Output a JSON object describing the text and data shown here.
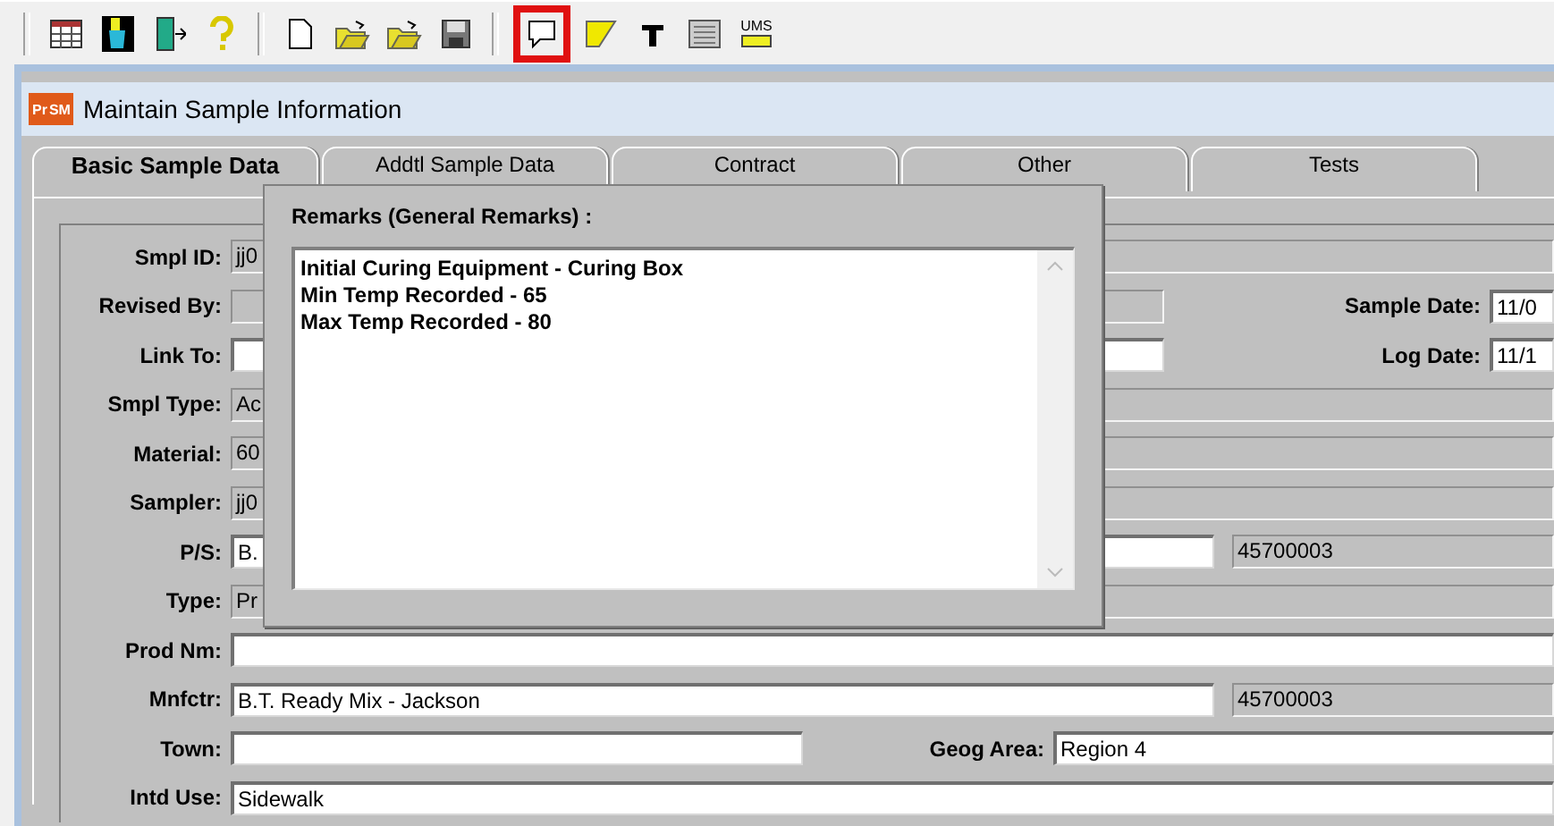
{
  "toolbar": [
    {
      "kind": "table",
      "selected": false
    },
    {
      "kind": "bucket",
      "selected": false
    },
    {
      "kind": "exit",
      "selected": false
    },
    {
      "kind": "help",
      "selected": false
    },
    {
      "kind": "new",
      "selected": false
    },
    {
      "kind": "open",
      "selected": false
    },
    {
      "kind": "open2",
      "selected": false
    },
    {
      "kind": "save",
      "selected": false
    },
    {
      "kind": "remarks",
      "selected": true
    },
    {
      "kind": "note",
      "selected": false
    },
    {
      "kind": "text",
      "selected": false
    },
    {
      "kind": "list",
      "selected": false
    },
    {
      "kind": "units",
      "selected": false,
      "label": "UMS"
    }
  ],
  "window": {
    "logo": [
      "Pr",
      "SM"
    ],
    "title": "Maintain Sample Information"
  },
  "tabs": [
    {
      "label": "Basic Sample Data",
      "selected": true
    },
    {
      "label": "Addtl Sample Data",
      "selected": false
    },
    {
      "label": "Contract",
      "selected": false
    },
    {
      "label": "Other",
      "selected": false
    },
    {
      "label": "Tests",
      "selected": false
    }
  ],
  "rows": [
    {
      "label": "Smpl ID:",
      "value": "jj0",
      "disabled": true
    },
    {
      "label": "Revised By:",
      "disabled": true,
      "side_label": "Sample Date:",
      "side_value": "11/0"
    },
    {
      "label": "Link To:",
      "disabled": false,
      "side_label": "Log Date:",
      "side_value": "11/1"
    },
    {
      "label": "Smpl Type:",
      "value": "Ac",
      "disabled": true
    },
    {
      "label": "Material:",
      "value": "60",
      "disabled": true
    },
    {
      "label": "Sampler:",
      "value": "jj0",
      "disabled": true
    },
    {
      "label": "P/S:",
      "value": "B.",
      "disabled": false,
      "code": "45700003"
    },
    {
      "label": "Type:",
      "value": "Pr",
      "disabled": true
    },
    {
      "label": "Prod Nm:",
      "disabled": false
    },
    {
      "label": "Mnfctr:",
      "value": "B.T. Ready Mix - Jackson",
      "disabled": false,
      "code": "45700003"
    },
    {
      "label": "Town:",
      "disabled": false,
      "area_label": "Geog Area:",
      "area_value": "Region 4"
    },
    {
      "label": "Intd Use:",
      "value": "Sidewalk",
      "disabled": false
    }
  ],
  "remarks": {
    "title": "Remarks (General Remarks) :",
    "lines": [
      "Initial Curing Equipment - Curing Box",
      "Min Temp Recorded - 65",
      "Max Temp Recorded - 80"
    ]
  }
}
